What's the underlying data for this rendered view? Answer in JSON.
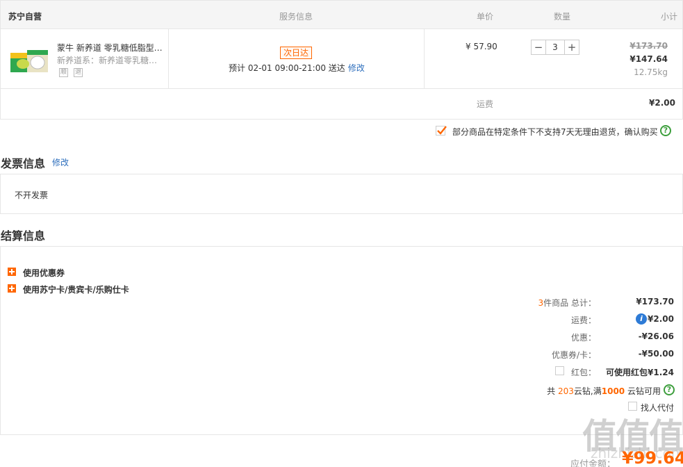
{
  "cart": {
    "header": {
      "store": "苏宁自营",
      "service": "服务信息",
      "unit_price": "单价",
      "quantity": "数量",
      "subtotal": "小计"
    },
    "item": {
      "name": "蒙牛 新养道 零乳糖低脂型…",
      "spec": "新养道系：新养道零乳糖…",
      "tag_1": "顺",
      "tag_2": "退",
      "delivery_badge": "次日达",
      "eta": "预计  02-01   09:00-21:00  送达",
      "eta_edit": "修改",
      "price": "¥ 57.90",
      "quantity": "3",
      "original_total": "¥173.70",
      "total": "¥147.64",
      "weight": "12.75kg"
    },
    "shipping_label": "运费",
    "shipping_value": "¥2.00",
    "notice": "部分商品在特定条件下不支持7天无理由退货，确认购买",
    "notice_checked": true
  },
  "invoice": {
    "title": "发票信息",
    "edit": "修改",
    "value": "不开发票"
  },
  "settlement": {
    "title": "结算信息",
    "options": [
      "使用优惠券",
      "使用苏宁卡/贵宾卡/乐购仕卡"
    ],
    "count_prefix": "3",
    "count_label": "件商品 总计：",
    "total": "¥173.70",
    "freight_label": "运费：",
    "freight": "¥2.00",
    "discount_label": "优惠：",
    "discount": "-¥26.06",
    "coupon_label": "优惠券/卡：",
    "coupon": "-¥50.00",
    "redpacket_label": "红包：",
    "redpacket": "可使用红包¥1.24",
    "coins_pre": "共",
    "coins_have": "203",
    "coins_mid": "云钻,满",
    "coins_need": "1000",
    "coins_post": "云钻可用",
    "proxy_pay": "找人代付",
    "due_label": "应付金额：",
    "due": "¥99.64"
  },
  "watermark": "值值值",
  "watermark_site": "zhizhizhi.com",
  "colors": {
    "accent": "#ff6600",
    "link": "#2e6fbd",
    "help": "#3c9e3c"
  }
}
